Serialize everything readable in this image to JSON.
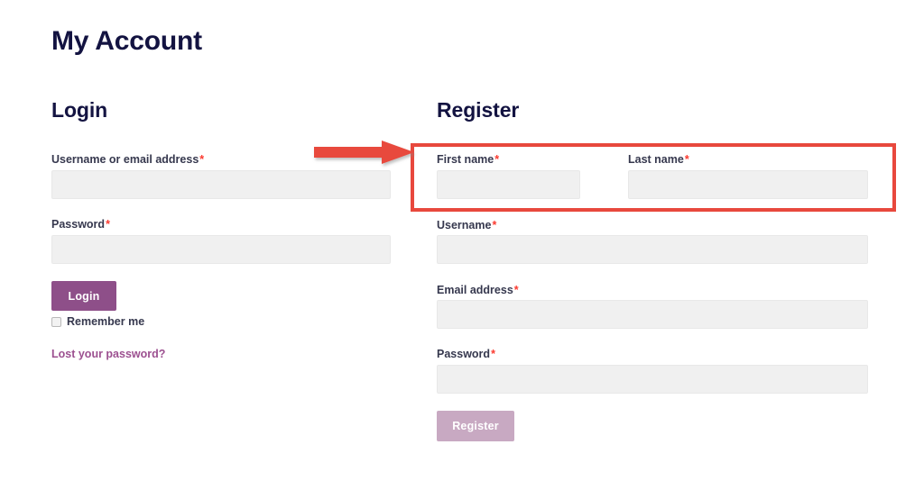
{
  "page": {
    "title": "My Account",
    "background": "#ffffff",
    "heading_color": "#131341"
  },
  "login": {
    "heading": "Login",
    "username": {
      "label": "Username or email address",
      "required_marker": "*",
      "value": "",
      "placeholder": ""
    },
    "password": {
      "label": "Password",
      "required_marker": "*",
      "value": "",
      "placeholder": ""
    },
    "submit_label": "Login",
    "submit_color": "#8e4f89",
    "remember_me": {
      "label": "Remember me",
      "checked": false
    },
    "lost_password_link": "Lost your password?",
    "link_color": "#9c5090"
  },
  "register": {
    "heading": "Register",
    "first_name": {
      "label": "First name",
      "required_marker": "*",
      "value": "",
      "placeholder": ""
    },
    "last_name": {
      "label": "Last name",
      "required_marker": "*",
      "value": "",
      "placeholder": ""
    },
    "username": {
      "label": "Username",
      "required_marker": "*",
      "value": "",
      "placeholder": ""
    },
    "email": {
      "label": "Email address",
      "required_marker": "*",
      "value": "",
      "placeholder": ""
    },
    "password": {
      "label": "Password",
      "required_marker": "*",
      "value": "",
      "placeholder": ""
    },
    "submit_label": "Register",
    "submit_color": "#c8a9c2"
  },
  "annotations": {
    "arrow": {
      "icon": "right-arrow-icon",
      "color": "#e8483d",
      "direction": "right"
    },
    "highlight": {
      "icon": "highlight-rectangle",
      "color": "#e8483d",
      "targets": "First name / Last name row"
    }
  },
  "colors": {
    "input_background": "#f0f0f0",
    "input_border": "#e8e8e8",
    "label_text": "#36384e",
    "required_asterisk": "#fb3a2f",
    "annotation_red": "#e8483d"
  }
}
